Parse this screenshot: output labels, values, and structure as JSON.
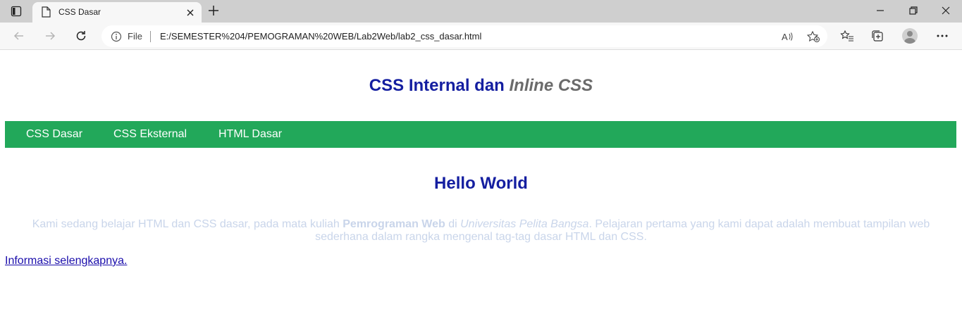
{
  "browser": {
    "tab_title": "CSS Dasar",
    "site_label": "File",
    "url": "E:/SEMESTER%204/PEMOGRAMAN%20WEB/Lab2Web/lab2_css_dasar.html"
  },
  "page": {
    "header_main": "CSS Internal dan ",
    "header_italic": "Inline CSS",
    "nav": [
      "CSS Dasar",
      "CSS Eksternal",
      "HTML Dasar"
    ],
    "heading": "Hello World",
    "para_1": "Kami sedang belajar HTML dan CSS dasar, pada mata kuliah ",
    "para_bold": "Pemrograman Web",
    "para_2": " di ",
    "para_italic": "Universitas Pelita Bangsa",
    "para_3": ". Pelajaran pertama yang kami dapat adalah membuat tampilan web sederhana dalam rangka mengenal tag-tag dasar HTML dan CSS.",
    "link_text": "Informasi selengkapnya."
  },
  "colors": {
    "heading": "#141ea0",
    "italic_gray": "#6b6b6b",
    "nav_bg": "#22a85a",
    "para": "#c9d5ea",
    "link": "#1a0dab"
  }
}
